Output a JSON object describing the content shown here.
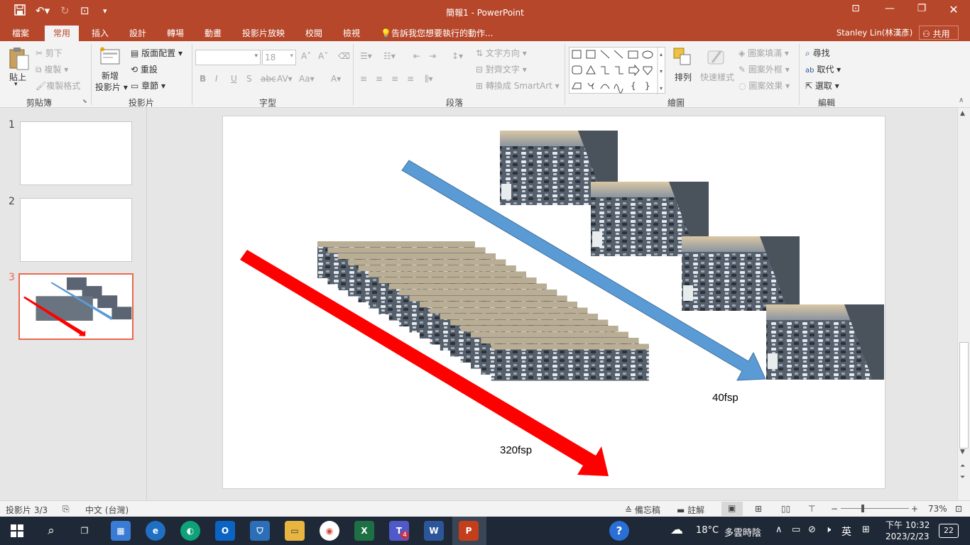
{
  "window": {
    "title": "簡報1 - PowerPoint"
  },
  "tabs": [
    "檔案",
    "常用",
    "插入",
    "設計",
    "轉場",
    "動畫",
    "投影片放映",
    "校閱",
    "檢視"
  ],
  "tell_me": "告訴我您想要執行的動作...",
  "user": {
    "name": "Stanley Lin(林漢彥)",
    "share": "共用"
  },
  "ribbon": {
    "clipboard": {
      "paste": "貼上",
      "cut": "剪下",
      "copy": "複製",
      "format_painter": "複製格式",
      "label": "剪貼簿"
    },
    "slides": {
      "new_slide_1": "新增",
      "new_slide_2": "投影片",
      "layout": "版面配置",
      "reset": "重設",
      "section": "章節",
      "label": "投影片"
    },
    "font": {
      "font_name": "",
      "font_size": "18",
      "label": "字型"
    },
    "paragraph": {
      "text_direction": "文字方向",
      "align_text": "對齊文字",
      "smartart": "轉換成 SmartArt",
      "label": "段落"
    },
    "drawing": {
      "arrange": "排列",
      "quick_styles": "快速樣式",
      "shape_fill": "圖案填滿",
      "shape_outline": "圖案外框",
      "shape_effects": "圖案效果",
      "label": "繪圖"
    },
    "editing": {
      "find": "尋找",
      "replace": "取代",
      "select": "選取",
      "label": "編輯"
    }
  },
  "slide_thumbnails": [
    "1",
    "2",
    "3"
  ],
  "slide": {
    "label_red": "320fsp",
    "label_blue": "40fsp",
    "colors": {
      "red_arrow": "#ff0000",
      "blue_arrow": "#5b9bd5"
    }
  },
  "status": {
    "slide_pos": "投影片 3/3",
    "language": "中文 (台灣)",
    "notes": "備忘稿",
    "comments": "註解",
    "zoom": "73%"
  },
  "taskbar": {
    "weather_temp": "18°C",
    "weather_desc": "多雲時陰",
    "ime": "英",
    "time": "下午 10:32",
    "date": "2023/2/23",
    "notif_count": "22",
    "teams_badge": "4"
  }
}
